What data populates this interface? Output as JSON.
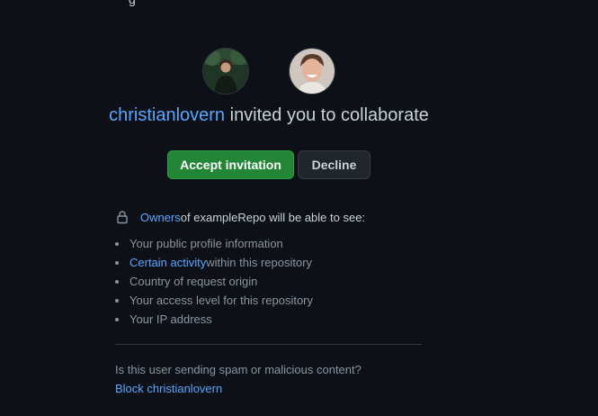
{
  "top_cut_text": "g",
  "inviter": {
    "username": "christianlovern"
  },
  "headline": {
    "suffix": " invited you to collaborate"
  },
  "actions": {
    "accept_label": "Accept invitation",
    "decline_label": "Decline"
  },
  "permissions": {
    "owners_link": "Owners",
    "intro_suffix": " of exampleRepo will be able to see:",
    "items": [
      {
        "text": "Your public profile information"
      },
      {
        "link": "Certain activity",
        "text": " within this repository"
      },
      {
        "text": "Country of request origin"
      },
      {
        "text": "Your access level for this repository"
      },
      {
        "text": "Your IP address"
      }
    ]
  },
  "spam": {
    "question": "Is this user sending spam or malicious content?",
    "block_label": "Block christianlovern"
  },
  "colors": {
    "background": "#0d1117",
    "link": "#58a6ff",
    "accept_button": "#238636",
    "decline_button": "#21262d",
    "text": "#c9d1d9",
    "muted_text": "#8b949e"
  },
  "icons": {
    "permission_icon": "lock-icon"
  }
}
